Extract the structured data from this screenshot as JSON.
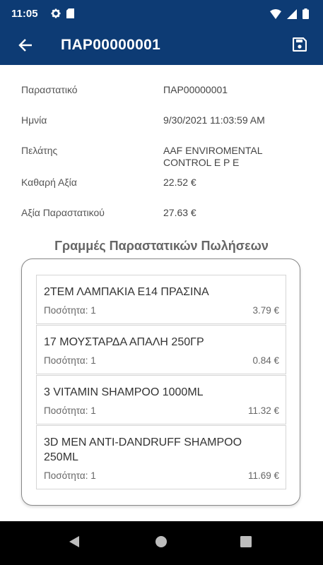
{
  "status_bar": {
    "time": "11:05",
    "icons": [
      "gear-icon",
      "sim-card-icon",
      "wifi-icon",
      "signal-icon",
      "battery-icon"
    ]
  },
  "app_bar": {
    "title": "ΠΑΡ00000001",
    "back_icon": "arrow-back-icon",
    "save_icon": "save-icon"
  },
  "details": [
    {
      "label": "Παραστατικό",
      "value": "ΠΑΡ00000001"
    },
    {
      "label": "Ημνία",
      "value": "9/30/2021 11:03:59 AM"
    },
    {
      "label": "Πελάτης",
      "value": "AAF ENVIROMENTAL CONTROL E P E"
    },
    {
      "label": "Καθαρή Αξία",
      "value": "22.52 €"
    },
    {
      "label": "Αξία Παραστατικού",
      "value": "27.63 €"
    }
  ],
  "lines_section": {
    "title": "Γραμμές Παραστατικών Πωλήσεων",
    "items": [
      {
        "name": "2ΤΕΜ ΛΑΜΠΑΚΙΑ Ε14 ΠΡΑΣΙΝΑ",
        "qty": "Ποσότητα: 1",
        "price": "3.79 €"
      },
      {
        "name": "17 ΜΟΥΣΤΑΡΔΑ ΑΠΑΛΗ 250ΓΡ",
        "qty": "Ποσότητα: 1",
        "price": "0.84 €"
      },
      {
        "name": "3 VITAMIN SHAMPOO 1000ML",
        "qty": "Ποσότητα: 1",
        "price": "11.32 €"
      },
      {
        "name": "3D MEN ANTI-DANDRUFF SHAMPOO 250ML",
        "qty": "Ποσότητα: 1",
        "price": "11.69 €"
      }
    ]
  },
  "nav_bar": {
    "icons": [
      "nav-back-icon",
      "nav-home-icon",
      "nav-recents-icon"
    ]
  },
  "colors": {
    "primary": "#0d3b74",
    "nav_bar": "#000000"
  }
}
